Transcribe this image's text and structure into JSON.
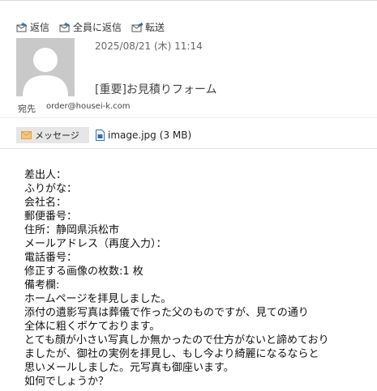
{
  "toolbar": {
    "reply": "返信",
    "reply_all": "全員に返信",
    "forward": "転送"
  },
  "header": {
    "date": "2025/08/21 (木) 11:14",
    "subject": "[重要]お見積りフォーム",
    "to_label": "宛先",
    "to_value": "order@housei-k.com"
  },
  "attachments": {
    "message_tab": "メッセージ",
    "file_name": "image.jpg",
    "file_size": "(3 MB)"
  },
  "body": {
    "lines": [
      "差出人：",
      "ふりがな：",
      "会社名：",
      "郵便番号：",
      "住所：静岡県浜松市",
      "メールアドレス（再度入力）：",
      "電話番号：",
      "修正する画像の枚数:1 枚",
      "備考欄:",
      "ホームページを拝見しました。",
      "添付の遺影写真は葬儀で作った父のものですが、見ての通り",
      "全体に粗くボケております。",
      "とても顔が小さい写真しか無かったので仕方がないと諦めており",
      "ましたが、御社の実例を拝見し、もし今より綺麗になるならと",
      "思いメールしました。元写真も御座います。",
      "如何でしょうか？"
    ]
  },
  "colors": {
    "icon_blue": "#2f6fb3",
    "avatar_bg": "#c9c9c9",
    "message_tab_bg": "#e6e6e6",
    "envelope_orange": "#e0a24a"
  }
}
